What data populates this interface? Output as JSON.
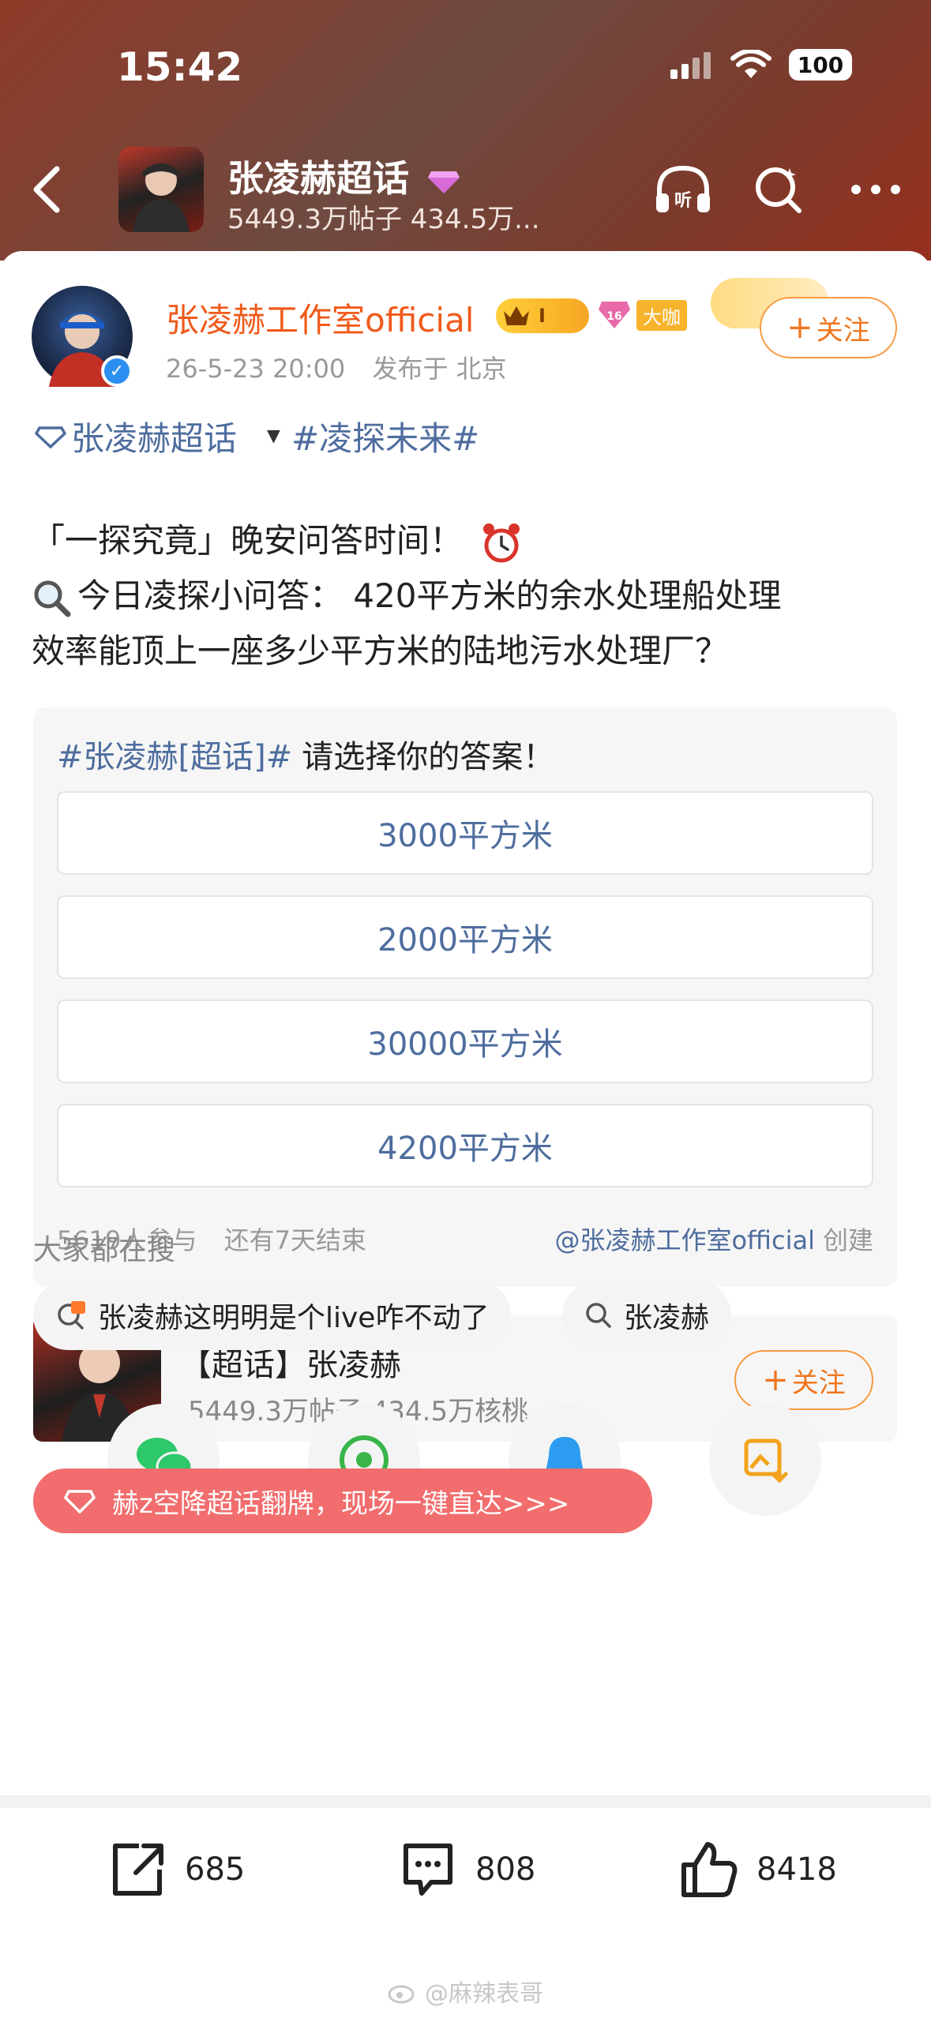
{
  "status": {
    "time": "15:42",
    "battery": "100"
  },
  "header": {
    "title": "张凌赫超话",
    "subtitle": "5449.3万帖子 434.5万..."
  },
  "post": {
    "author": "张凌赫工作室official",
    "level": "I",
    "gem_level": "16",
    "badge": "大咖",
    "date": "26-5-23 20:00",
    "location": "发布于 北京",
    "follow_label": "关注",
    "topic1": "张凌赫超话",
    "topic2": "#凌探未来#",
    "line1": "「一探究竟」晚安问答时间！",
    "line2": "今日凌探小问答：  420平方米的余水处理船处理",
    "line3": "效率能顶上一座多少平方米的陆地污水处理厂？"
  },
  "poll": {
    "tag": "#张凌赫[超话]#",
    "question": "请选择你的答案！",
    "options": [
      "3000平方米",
      "2000平方米",
      "30000平方米",
      "4200平方米"
    ],
    "participants": "5619人参与",
    "remaining": "还有7天结束",
    "creator": "@张凌赫工作室official",
    "created": "创建"
  },
  "topic_card": {
    "title": "【超话】张凌赫",
    "subtitle": "5449.3万帖子 434.5万核桃",
    "follow_label": "关注"
  },
  "search": {
    "heading": "大家都在搜",
    "chip1": "张凌赫这明明是个live咋不动了",
    "chip2": "张凌赫"
  },
  "toast": {
    "text": "赫z空降超话翻牌，现场一键直达>>>"
  },
  "actions": {
    "share": "685",
    "comment": "808",
    "like": "8418"
  },
  "watermark": "@麻辣表哥",
  "colors": {
    "accent_orange": "#f0761f",
    "link_blue": "#4e6d9e",
    "toast_red": "#f26d6d"
  }
}
